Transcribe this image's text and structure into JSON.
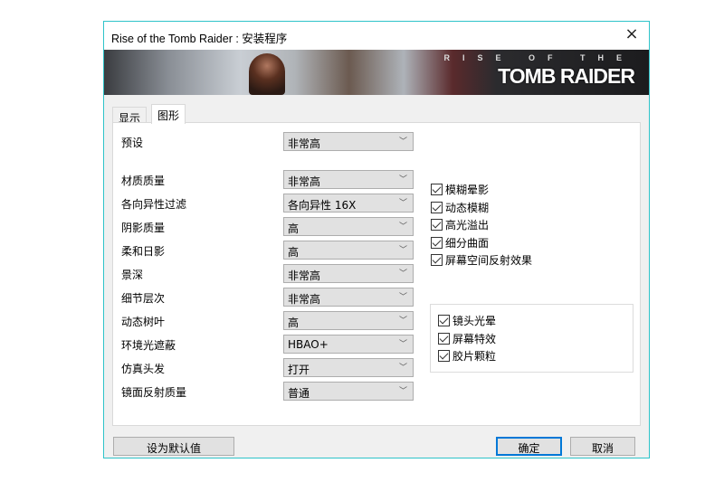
{
  "window": {
    "title": "Rise of the Tomb Raider : 安装程序",
    "close_icon": "×"
  },
  "banner": {
    "logo_line1": "RISE OF THE",
    "logo_line2": "TOMB RAIDER"
  },
  "tabs": [
    {
      "label": "显示",
      "active": false
    },
    {
      "label": "图形",
      "active": true
    }
  ],
  "preset": {
    "label": "预设",
    "value": "非常高"
  },
  "settings": [
    {
      "label": "材质质量",
      "value": "非常高"
    },
    {
      "label": "各向异性过滤",
      "value": "各向异性 16X"
    },
    {
      "label": "阴影质量",
      "value": "高"
    },
    {
      "label": "柔和日影",
      "value": "高"
    },
    {
      "label": "景深",
      "value": "非常高"
    },
    {
      "label": "细节层次",
      "value": "非常高"
    },
    {
      "label": "动态树叶",
      "value": "高"
    },
    {
      "label": "环境光遮蔽",
      "value": "HBAO+"
    },
    {
      "label": "仿真头发",
      "value": "打开"
    },
    {
      "label": "镜面反射质量",
      "value": "普通"
    }
  ],
  "checkboxes": [
    {
      "label": "模糊晕影",
      "checked": true
    },
    {
      "label": "动态模糊",
      "checked": true
    },
    {
      "label": "高光溢出",
      "checked": true
    },
    {
      "label": "细分曲面",
      "checked": true
    },
    {
      "label": "屏幕空间反射效果",
      "checked": true
    }
  ],
  "group_checkboxes": [
    {
      "label": "镜头光晕",
      "checked": true
    },
    {
      "label": "屏幕特效",
      "checked": true
    },
    {
      "label": "胶片颗粒",
      "checked": true
    }
  ],
  "buttons": {
    "defaults": "设为默认值",
    "ok": "确定",
    "cancel": "取消"
  },
  "colors": {
    "border": "#2ec3c9",
    "primary_button": "#0078d7"
  }
}
